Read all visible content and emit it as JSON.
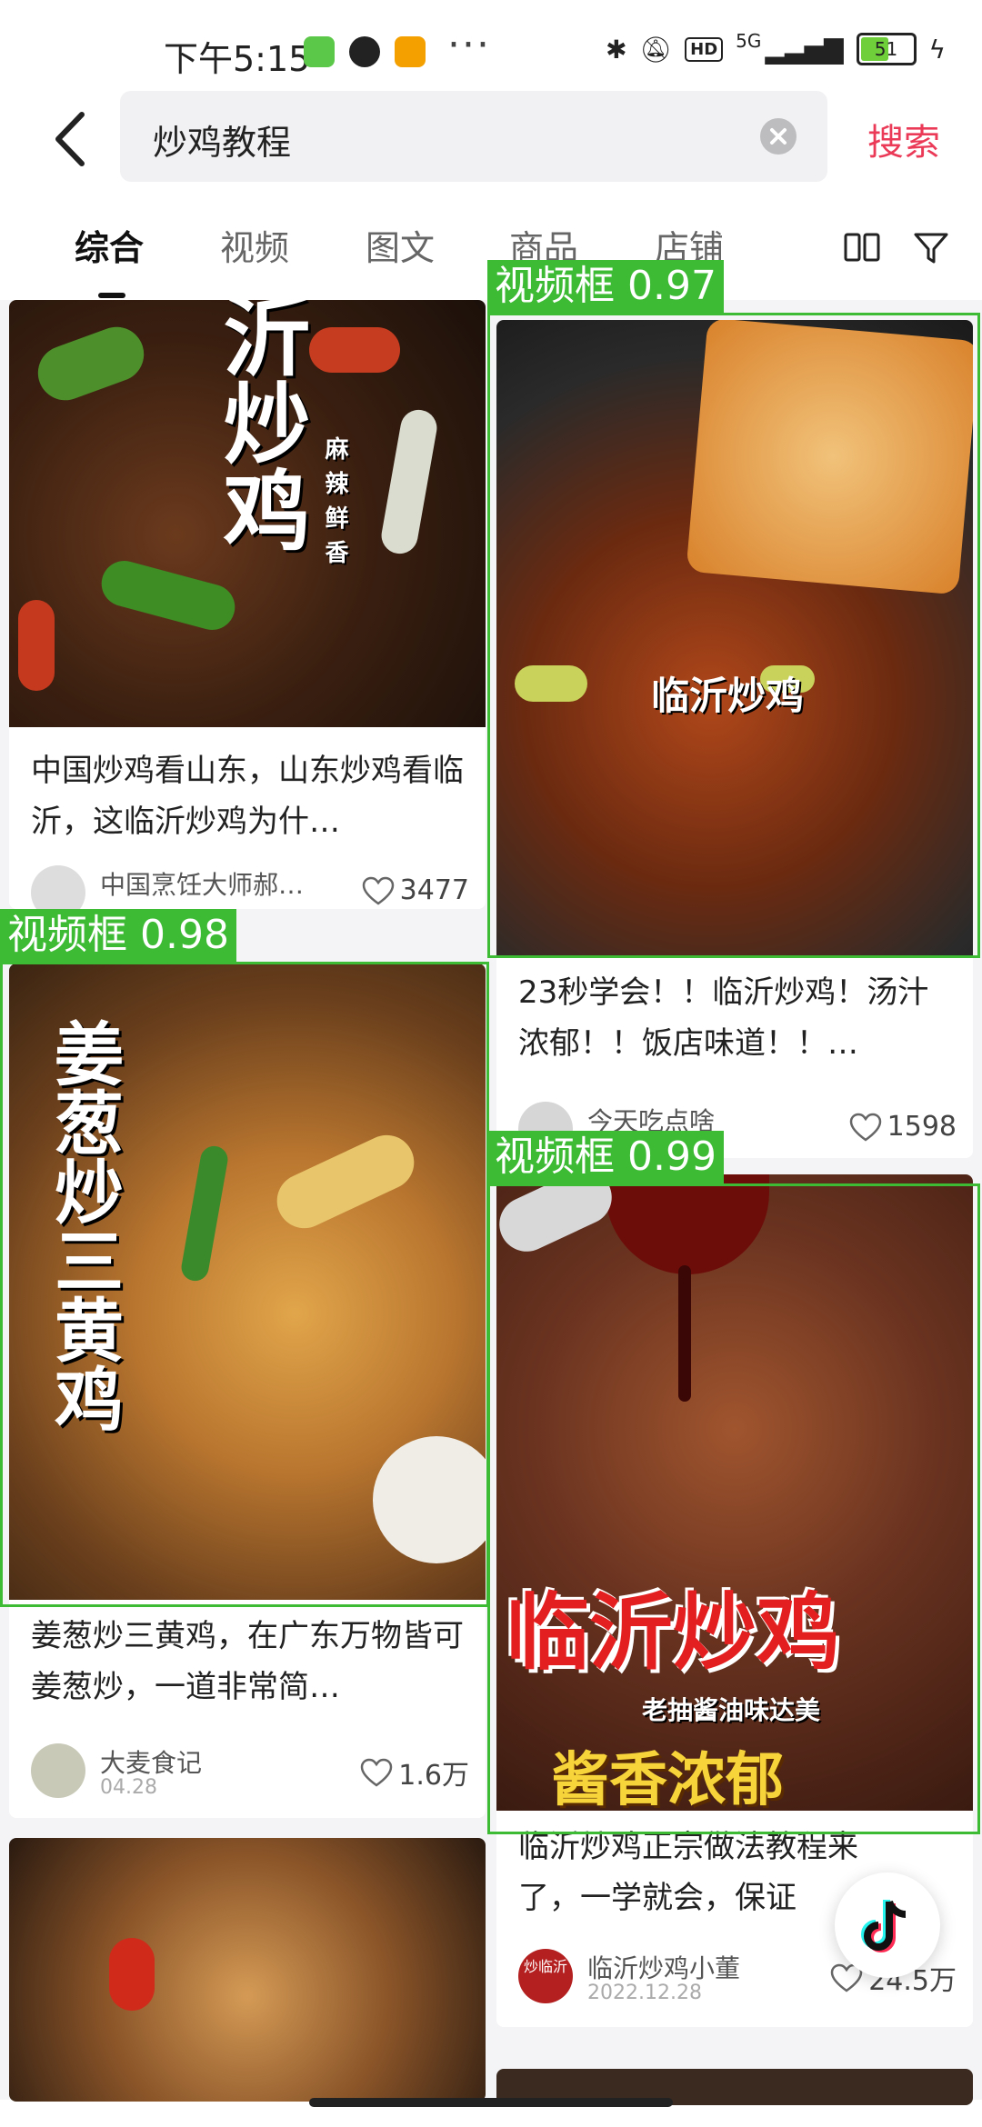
{
  "status_bar": {
    "time": "下午5:15",
    "dots": "···",
    "network": "5G",
    "hd": "HD",
    "battery": "51"
  },
  "search": {
    "query": "炒鸡教程",
    "submit_label": "搜索"
  },
  "tabs": [
    {
      "label": "综合"
    },
    {
      "label": "视频"
    },
    {
      "label": "图文"
    },
    {
      "label": "商品"
    },
    {
      "label": "店铺"
    }
  ],
  "cards": [
    {
      "overlay_lines": [
        "沂",
        "炒",
        "鸡"
      ],
      "overlay_small": "麻辣鲜香",
      "title": "中国炒鸡看山东，山东炒鸡看临沂，这临沂炒鸡为什…",
      "author": "中国烹饪大师郝…",
      "likes": "3477"
    },
    {
      "overlay_text": "临沂炒鸡",
      "title": "23秒学会！！临沂炒鸡！汤汁浓郁！！饭店味道！！…",
      "author": "今天吃点啥",
      "likes": "1598"
    },
    {
      "overlay_text": "姜葱炒三黄鸡",
      "title": "姜葱炒三黄鸡，在广东万物皆可姜葱炒，一道非常简…",
      "author": "大麦食记",
      "date": "04.28",
      "likes": "1.6万"
    },
    {
      "overlay_big": "临沂炒鸡",
      "overlay_sub": "老抽酱油味达美",
      "overlay_bottom": "酱香浓郁",
      "title": "临沂炒鸡正宗做法教程来了，一学就会，保证",
      "author": "临沂炒鸡小董",
      "date": "2022.12.28",
      "likes": "24.5万",
      "avatar_text": "炒临沂"
    }
  ],
  "detections": [
    {
      "label": "视频框 0.97"
    },
    {
      "label": "视频框 0.98"
    },
    {
      "label": "视频框 0.99"
    }
  ],
  "colors": {
    "accent": "#ea3a58",
    "detection": "#3dbb35",
    "feed_bg": "#f4f4f6"
  }
}
